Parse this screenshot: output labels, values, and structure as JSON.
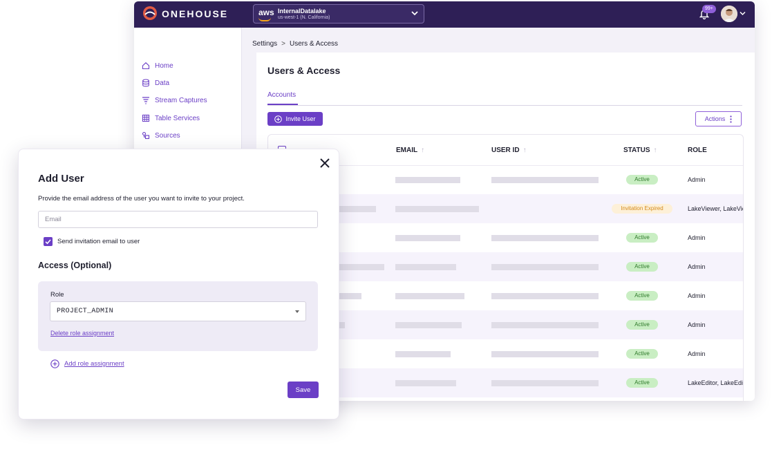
{
  "header": {
    "brand": "ONEHOUSE",
    "environment": {
      "provider": "aws",
      "name": "InternalDatalake",
      "region": "us-west-1 (N. California)"
    },
    "notification_count": "99+"
  },
  "sidebar": {
    "items": [
      {
        "label": "Home",
        "icon": "home-icon"
      },
      {
        "label": "Data",
        "icon": "database-icon"
      },
      {
        "label": "Stream Captures",
        "icon": "filter-icon"
      },
      {
        "label": "Table Services",
        "icon": "table-icon"
      },
      {
        "label": "Sources",
        "icon": "sources-icon"
      }
    ]
  },
  "breadcrumb": {
    "parent": "Settings",
    "separator": ">",
    "current": "Users & Access"
  },
  "page": {
    "title": "Users & Access",
    "tab": "Accounts",
    "invite_label": "Invite User",
    "actions_label": "Actions"
  },
  "table": {
    "columns": [
      "EMAIL",
      "USER ID",
      "STATUS",
      "ROLE"
    ],
    "rows": [
      {
        "status": "Active",
        "role": "Admin"
      },
      {
        "status": "Invitation Expired",
        "role": "LakeViewer, LakeViewer"
      },
      {
        "status": "Active",
        "role": "Admin"
      },
      {
        "status": "Active",
        "role": "Admin"
      },
      {
        "status": "Active",
        "role": "Admin"
      },
      {
        "status": "Active",
        "role": "Admin"
      },
      {
        "status": "Active",
        "role": "Admin"
      },
      {
        "status": "Active",
        "role": "LakeEditor, LakeEditor"
      }
    ]
  },
  "modal": {
    "title": "Add User",
    "description": "Provide the email address of the user you want to invite to your project.",
    "email_placeholder": "Email",
    "send_invitation_label": "Send invitation email to user",
    "send_invitation_checked": true,
    "access_title": "Access (Optional)",
    "role_label": "Role",
    "role_value": "PROJECT_ADMIN",
    "delete_role_label": "Delete role assignment",
    "add_role_label": "Add role assignment",
    "save_label": "Save"
  },
  "colors": {
    "brand_dark": "#2e1f56",
    "accent": "#6b3fc6",
    "active_badge": "#c9eec3",
    "expired_badge": "#fdf0d8"
  }
}
